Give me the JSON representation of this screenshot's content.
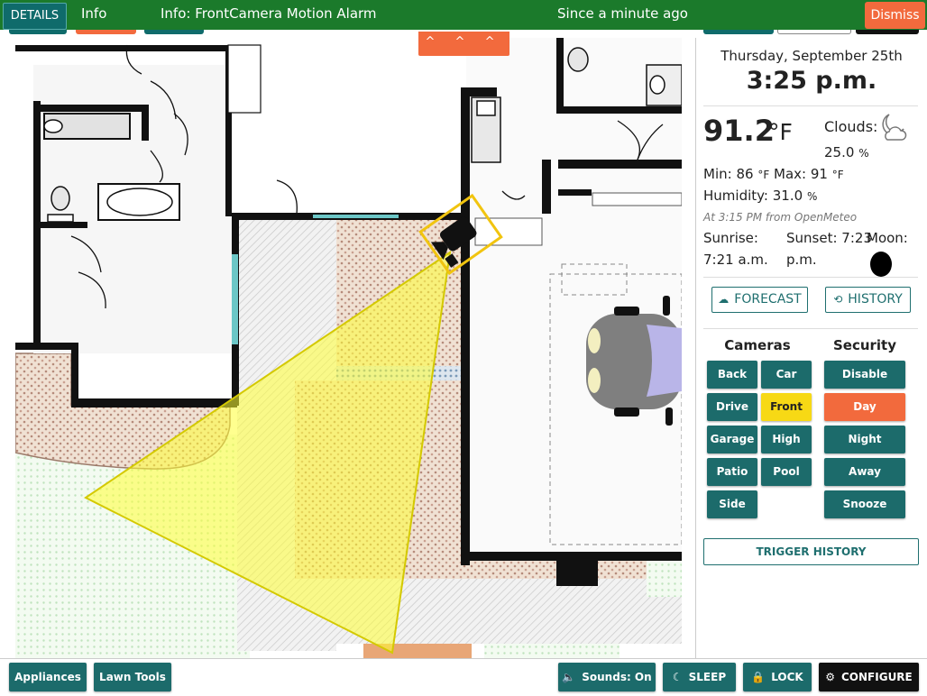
{
  "notification": {
    "details_label": "DETAILS",
    "info_label": "Info",
    "message": "Info: FrontCamera Motion Alarm",
    "since": "Since a minute ago",
    "dismiss_label": "Dismiss"
  },
  "map": {
    "expand_chevrons": "^ ^ ^ ^",
    "active_camera": "Front",
    "icons": [
      "camera-icon",
      "car-icon"
    ]
  },
  "clock": {
    "date": "Thursday, September 25th",
    "time": "3:25 p.m."
  },
  "weather": {
    "temperature": "91.2",
    "temperature_unit": "°F",
    "clouds_label": "Clouds:",
    "clouds_value": "25.0",
    "clouds_unit": "%",
    "min_label": "Min:",
    "min_value": "86",
    "max_label": "Max:",
    "max_value": "91",
    "temp_unit_small": "°F",
    "humidity_label": "Humidity:",
    "humidity_value": "31.0",
    "humidity_unit": "%",
    "source": "At 3:15 PM from OpenMeteo",
    "sunrise_label": "Sunrise:",
    "sunrise_value": "7:21 a.m.",
    "sunset_label": "Sunset:",
    "sunset_value": "7:23",
    "sunset_suffix": "p.m.",
    "moon_label": "Moon:",
    "forecast_label": "FORECAST",
    "history_label": "HISTORY",
    "icons": [
      "cloud-moon-icon",
      "moon-icon",
      "cloud-icon",
      "history-icon"
    ]
  },
  "cameras": {
    "title": "Cameras",
    "buttons": [
      "Back",
      "Car",
      "Drive",
      "Front",
      "Garage",
      "High",
      "Patio",
      "Pool",
      "Side"
    ],
    "active": "Front",
    "active_color": "#f7d915"
  },
  "security": {
    "title": "Security",
    "buttons": [
      "Disable",
      "Day",
      "Night",
      "Away",
      "Snooze"
    ],
    "active": "Day",
    "active_color": "#f26a3d"
  },
  "trigger_history_label": "TRIGGER HISTORY",
  "bottom": {
    "appliances_label": "Appliances",
    "lawn_tools_label": "Lawn Tools",
    "sounds_label": "Sounds: On",
    "sleep_label": "SLEEP",
    "lock_label": "LOCK",
    "configure_label": "CONFIGURE",
    "icons": [
      "speaker-icon",
      "moon-sleep-icon",
      "lock-icon",
      "gear-icon"
    ]
  },
  "colors": {
    "topbar": "#1b7a2b",
    "teal": "#1c6b6b",
    "orange": "#f26a3d",
    "yellow": "#f7d915"
  }
}
